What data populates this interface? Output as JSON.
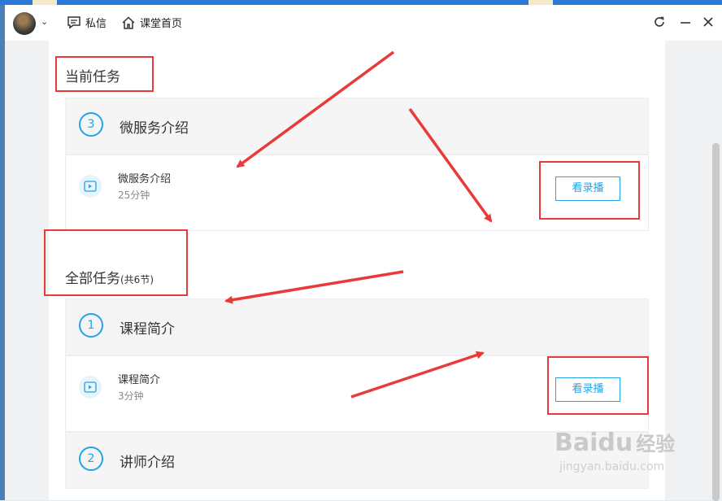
{
  "toolbar": {
    "message_label": "私信",
    "home_label": "课堂首页"
  },
  "current_tasks": {
    "title": "当前任务",
    "chapter": {
      "number": "3",
      "title": "微服务介绍"
    },
    "lesson": {
      "title": "微服务介绍",
      "duration": "25分钟",
      "button_label": "看录播"
    }
  },
  "all_tasks": {
    "title": "全部任务",
    "count_label": "(共6节)",
    "chapters": [
      {
        "number": "1",
        "title": "课程简介"
      },
      {
        "number": "2",
        "title": "讲师介绍"
      }
    ],
    "lesson": {
      "title": "课程简介",
      "duration": "3分钟",
      "button_label": "看录播"
    }
  },
  "watermark": {
    "logo_text": "Baidu",
    "logo_cn": "经验",
    "url": "jingyan.baidu.com"
  },
  "colors": {
    "accent": "#21a4e8",
    "annotation": "#e83a3a"
  }
}
